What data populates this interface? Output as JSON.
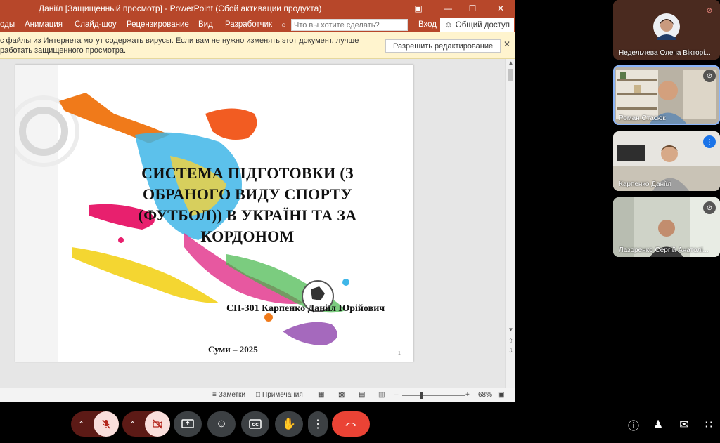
{
  "ppt": {
    "window_title": "Даніїл [Защищенный просмотр] - PowerPoint (Сбой активации продукта)",
    "tabs": [
      "оды",
      "Анимация",
      "Слайд-шоу",
      "Рецензирование",
      "Вид",
      "Разработчик"
    ],
    "tell_me_placeholder": "Что вы хотите сделать?",
    "signin": "Вход",
    "share": "Общий доступ",
    "infobar_message": "с файлы из Интернета могут содержать вирусы. Если вам не нужно изменять этот документ, лучше работать защищенного просмотра.",
    "enable_editing": "Разрешить редактирование",
    "slide": {
      "title": "СИСТЕМА ПІДГОТОВКИ (З ОБРАНОГО ВИДУ СПОРТУ (ФУТБОЛ)) В УКРАЇНІ ТА ЗА КОРДОНОМ",
      "author": "СП-301 Карпенко Даніїл Юрійович",
      "city": "Суми – 2025",
      "number": "1"
    },
    "status": {
      "notes": "Заметки",
      "comments": "Примечания",
      "zoom": "68%",
      "zoom_level_percent": 68
    }
  },
  "participants": [
    {
      "name": "Недельчева Олена Вікторі...",
      "muted": true
    },
    {
      "name": "Роман Стасюк",
      "muted": true,
      "active": true
    },
    {
      "name": "Карпенко Даніїл",
      "speaking": true
    },
    {
      "name": "Лазоренко Сергій Анатолі...",
      "muted": true
    }
  ],
  "colors": {
    "ppt_accent": "#b7472a",
    "meet_red": "#ea4335",
    "meet_dark": "#3c4043"
  }
}
